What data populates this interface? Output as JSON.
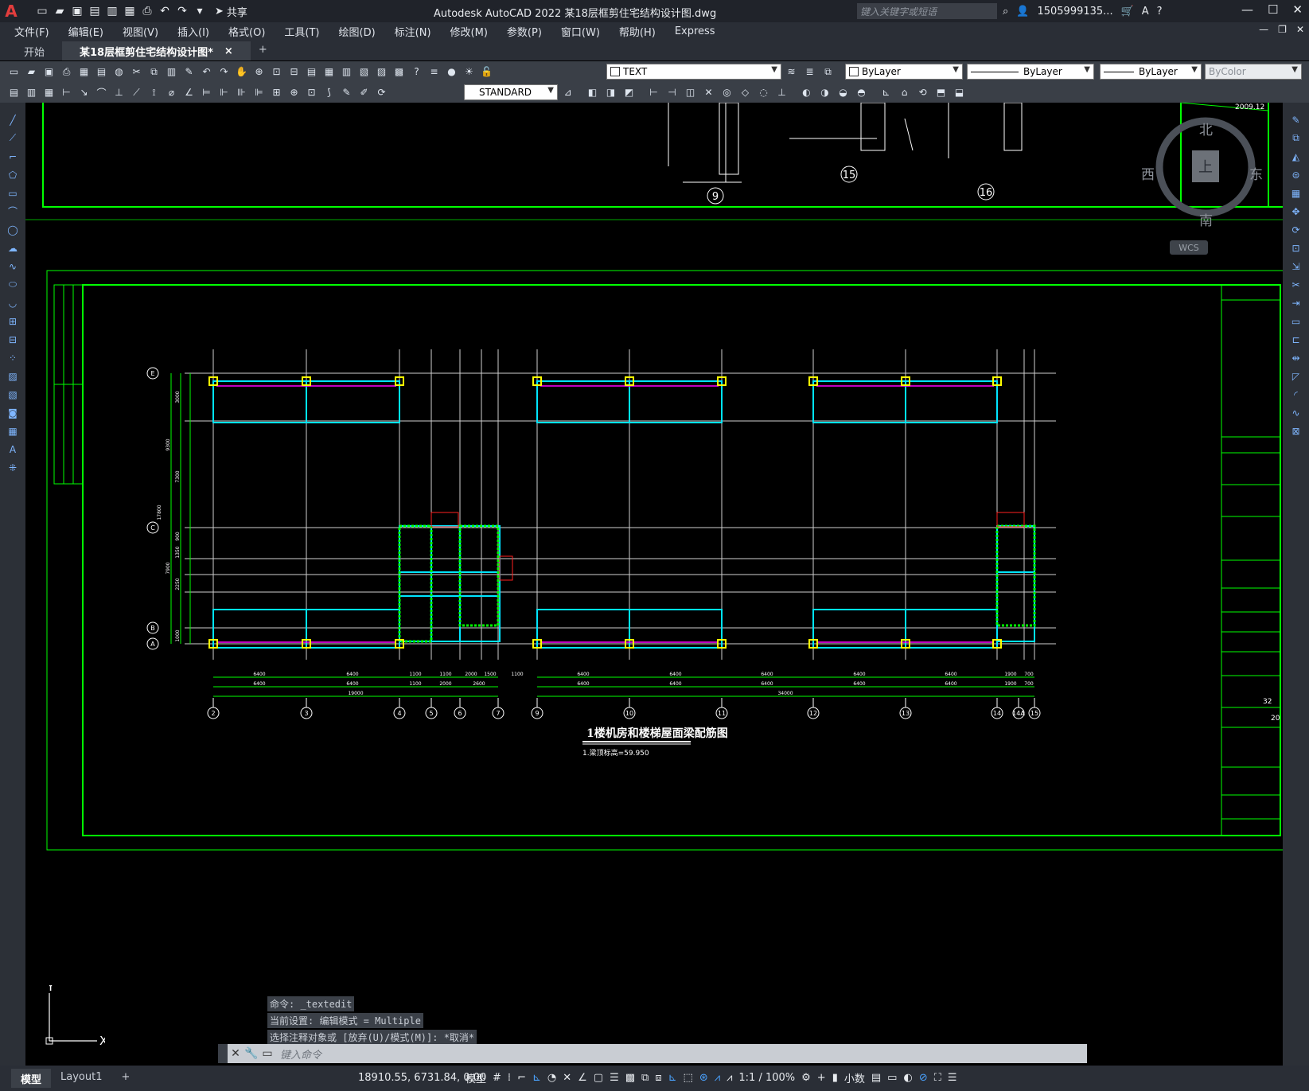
{
  "app": {
    "logo": "A",
    "title": "Autodesk AutoCAD 2022    某18层框剪住宅结构设计图.dwg",
    "share_label": "共享",
    "search_placeholder": "键入关键字或短语",
    "user": "1505999135...",
    "help": "?"
  },
  "menu": [
    "文件(F)",
    "编辑(E)",
    "视图(V)",
    "插入(I)",
    "格式(O)",
    "工具(T)",
    "绘图(D)",
    "标注(N)",
    "修改(M)",
    "参数(P)",
    "窗口(W)",
    "帮助(H)",
    "Express"
  ],
  "tabs": {
    "start": "开始",
    "doc": "某18层框剪住宅结构设计图*",
    "close": "×",
    "add": "+"
  },
  "properties": {
    "layer_name": "TEXT",
    "color": "ByLayer",
    "linetype": "ByLayer",
    "lineweight": "ByLayer",
    "plotstyle": "ByColor",
    "textstyle": "STANDARD"
  },
  "viewcube": {
    "north": "北",
    "south": "南",
    "east": "东",
    "west": "西",
    "top": "上",
    "wcs": "WCS"
  },
  "drawing": {
    "title": "1楼机房和楼梯屋面梁配筋图",
    "note": "1.梁顶标高=59.950",
    "top_detail_numbers": [
      "9",
      "15",
      "16"
    ],
    "grid_bubbles": [
      "2",
      "3",
      "4",
      "5",
      "6",
      "7",
      "9",
      "10",
      "11",
      "12",
      "13",
      "14",
      "14A",
      "15"
    ],
    "row_bubbles": [
      "E",
      "C",
      "B",
      "A"
    ],
    "dim_top_row": [
      "6400",
      "6400",
      "1100",
      "1100",
      "2000",
      "1500",
      "1100",
      "6400",
      "6400",
      "6400",
      "6400",
      "6400",
      "1900",
      "700"
    ],
    "dim_mid_row": [
      "6400",
      "6400",
      "1100",
      "2000",
      "2600",
      "6400",
      "6400",
      "6400",
      "6400",
      "6400",
      "1900",
      "700"
    ],
    "dim_totals": [
      "19000",
      "34000"
    ],
    "left_dims": [
      "3000",
      "9300",
      "7300",
      "17800",
      "900",
      "1350",
      "7900",
      "2250",
      "1000"
    ],
    "sheet_date": "2009.12",
    "sheet_no": "32",
    "sheet_no2": "20"
  },
  "command": {
    "history": [
      "命令: _textedit",
      "当前设置: 编辑模式 = Multiple",
      "选择注释对象或 [放弃(U)/模式(M)]: *取消*"
    ],
    "placeholder": "键入命令"
  },
  "ucs": {
    "x": "X",
    "y": "Y"
  },
  "status": {
    "model_tab": "模型",
    "layout_tab": "Layout1",
    "add_tab": "+",
    "coords": "18910.55, 6731.84, 0.00",
    "space": "模型",
    "scale": "1:1 / 100%",
    "units": "小数"
  }
}
